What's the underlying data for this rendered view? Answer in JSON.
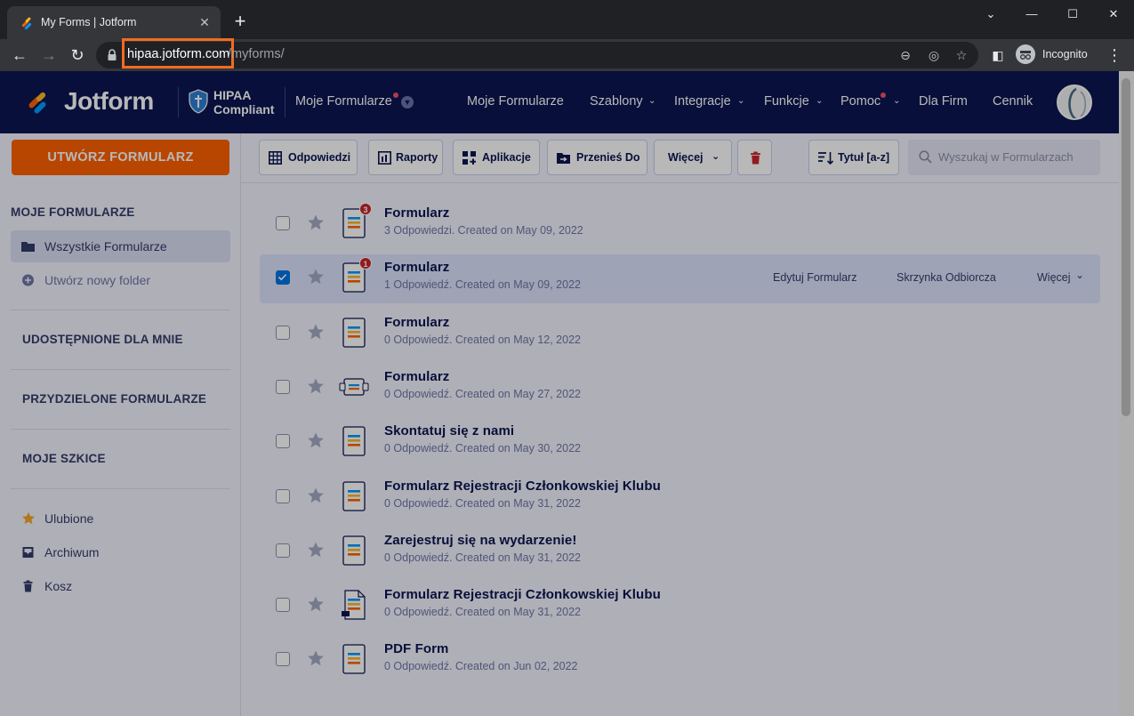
{
  "browser": {
    "tab_title": "My Forms | Jotform",
    "new_tab": "+",
    "url_domain": "hipaa.jotform.com",
    "url_path": "/myforms/",
    "incognito_label": "Incognito"
  },
  "header": {
    "logo_text": "Jotform",
    "hipaa_line1": "HIPAA",
    "hipaa_line2": "Compliant",
    "my_forms_dropdown": "Moje Formularze",
    "nav": [
      {
        "label": "Moje Formularze"
      },
      {
        "label": "Szablony"
      },
      {
        "label": "Integracje"
      },
      {
        "label": "Funkcje"
      },
      {
        "label": "Pomoc"
      },
      {
        "label": "Dla Firm"
      },
      {
        "label": "Cennik"
      }
    ]
  },
  "sidebar": {
    "create_button": "UTWÓRZ FORMULARZ",
    "my_forms_heading": "MOJE FORMULARZE",
    "all_forms": "Wszystkie Formularze",
    "new_folder": "Utwórz nowy folder",
    "shared_heading": "UDOSTĘPNIONE DLA MNIE",
    "assigned_heading": "PRZYDZIELONE FORMULARZE",
    "drafts_heading": "MOJE SZKICE",
    "favorites": "Ulubione",
    "archive": "Archiwum",
    "trash": "Kosz"
  },
  "toolbar": {
    "responses": "Odpowiedzi",
    "reports": "Raporty",
    "apps": "Aplikacje",
    "move_to": "Przenieś Do",
    "more": "Więcej",
    "sort": "Tytuł [a-z]",
    "search_placeholder": "Wyszukaj w Formularzach"
  },
  "forms": [
    {
      "title": "Formularz",
      "meta": "3 Odpowiedzi. Created on May 09, 2022",
      "badge": "3",
      "selected": false,
      "icon": "form-icon"
    },
    {
      "title": "Formularz",
      "meta": "1 Odpowiedź. Created on May 09, 2022",
      "badge": "1",
      "selected": true,
      "icon": "form-icon"
    },
    {
      "title": "Formularz",
      "meta": "0 Odpowiedź. Created on May 12, 2022",
      "badge": "",
      "selected": false,
      "icon": "form-icon"
    },
    {
      "title": "Formularz",
      "meta": "0 Odpowiedź. Created on May 27, 2022",
      "badge": "",
      "selected": false,
      "icon": "card-form-icon"
    },
    {
      "title": "Skontatuj się z nami",
      "meta": "0 Odpowiedź. Created on May 30, 2022",
      "badge": "",
      "selected": false,
      "icon": "form-icon"
    },
    {
      "title": "Formularz Rejestracji Członkowskiej Klubu",
      "meta": "0 Odpowiedź. Created on May 31, 2022",
      "badge": "",
      "selected": false,
      "icon": "form-icon"
    },
    {
      "title": "Zarejestruj się na wydarzenie!",
      "meta": "0 Odpowiedź. Created on May 31, 2022",
      "badge": "",
      "selected": false,
      "icon": "form-icon"
    },
    {
      "title": "Formularz Rejestracji Członkowskiej Klubu",
      "meta": "0 Odpowiedź. Created on May 31, 2022",
      "badge": "",
      "selected": false,
      "icon": "pdf-form-icon"
    },
    {
      "title": "PDF Form",
      "meta": "0 Odpowiedź. Created on Jun 02, 2022",
      "badge": "",
      "selected": false,
      "icon": "form-icon"
    }
  ],
  "row_actions": {
    "edit": "Edytuj Formularz",
    "inbox": "Skrzynka Odbiorcza",
    "more": "Więcej"
  },
  "colors": {
    "brand_navy": "#0a1551",
    "brand_orange": "#ff6100",
    "highlight_box": "#f26b21",
    "checkbox_blue": "#0075e3",
    "badge_red": "#c9252c"
  }
}
